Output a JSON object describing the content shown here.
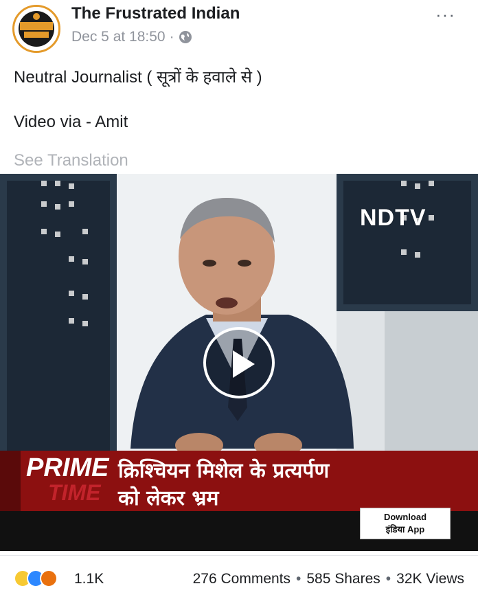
{
  "post": {
    "page_name": "The Frustrated Indian",
    "timestamp": "Dec 5 at 18:50",
    "separator": "·",
    "audience_icon": "globe-icon",
    "more_icon": "more-options-icon",
    "more_text": "···",
    "text_line1": "Neutral Journalist ( सूत्रों के हवाले से )",
    "text_line2": "Video via - Amit",
    "see_translation": "See Translation"
  },
  "video": {
    "channel_logo": "NDTV",
    "show_name_1": "PRIME",
    "show_name_2": "TIME",
    "headline_line1": "क्रिश्चियन मिशेल के प्रत्यर्पण",
    "headline_line2": "को लेकर भ्रम",
    "download_line1": "Download",
    "download_line2": "इंडिया App",
    "play_icon": "play-icon"
  },
  "footer": {
    "reaction_icons": [
      "haha-icon",
      "like-icon",
      "angry-icon"
    ],
    "reaction_count": "1.1K",
    "comments": "276 Comments",
    "shares": "585 Shares",
    "views": "32K Views",
    "dot": "•"
  },
  "colors": {
    "ticker_red": "#8c1010",
    "meta_gray": "#90949c",
    "like_blue": "#2d88ff"
  }
}
